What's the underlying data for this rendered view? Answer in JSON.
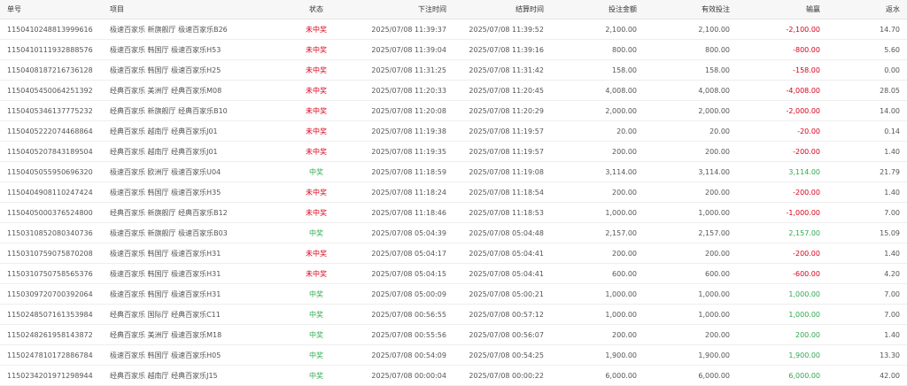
{
  "colors": {
    "lose": "#d9001b",
    "win": "#2fa84f",
    "neutral": "#555555"
  },
  "table": {
    "headers": [
      "单号",
      "项目",
      "状态",
      "下注时间",
      "结算时间",
      "投注金额",
      "有效投注",
      "输赢",
      "返水"
    ],
    "rows": [
      [
        "1150410248813999616",
        "极速百家乐 新旗舰厅 极速百家乐B26",
        "未中奖",
        "2025/07/08 11:39:37",
        "2025/07/08 11:39:52",
        "2,100.00",
        "2,100.00",
        "-2,100.00",
        "14.70"
      ],
      [
        "1150410111932888576",
        "极速百家乐 韩国厅 极速百家乐H53",
        "未中奖",
        "2025/07/08 11:39:04",
        "2025/07/08 11:39:16",
        "800.00",
        "800.00",
        "-800.00",
        "5.60"
      ],
      [
        "1150408187216736128",
        "极速百家乐 韩国厅 极速百家乐H25",
        "未中奖",
        "2025/07/08 11:31:25",
        "2025/07/08 11:31:42",
        "158.00",
        "158.00",
        "-158.00",
        "0.00"
      ],
      [
        "1150405450064251392",
        "经典百家乐 美洲厅 经典百家乐M08",
        "未中奖",
        "2025/07/08 11:20:33",
        "2025/07/08 11:20:45",
        "4,008.00",
        "4,008.00",
        "-4,008.00",
        "28.05"
      ],
      [
        "1150405346137775232",
        "经典百家乐 新旗舰厅 经典百家乐B10",
        "未中奖",
        "2025/07/08 11:20:08",
        "2025/07/08 11:20:29",
        "2,000.00",
        "2,000.00",
        "-2,000.00",
        "14.00"
      ],
      [
        "1150405222074468864",
        "经典百家乐 越南厅 经典百家乐J01",
        "未中奖",
        "2025/07/08 11:19:38",
        "2025/07/08 11:19:57",
        "20.00",
        "20.00",
        "-20.00",
        "0.14"
      ],
      [
        "1150405207843189504",
        "经典百家乐 越南厅 经典百家乐J01",
        "未中奖",
        "2025/07/08 11:19:35",
        "2025/07/08 11:19:57",
        "200.00",
        "200.00",
        "-200.00",
        "1.40"
      ],
      [
        "1150405055950696320",
        "极速百家乐 欧洲厅 极速百家乐U04",
        "中奖",
        "2025/07/08 11:18:59",
        "2025/07/08 11:19:08",
        "3,114.00",
        "3,114.00",
        "3,114.00",
        "21.79"
      ],
      [
        "1150404908110247424",
        "极速百家乐 韩国厅 极速百家乐H35",
        "未中奖",
        "2025/07/08 11:18:24",
        "2025/07/08 11:18:54",
        "200.00",
        "200.00",
        "-200.00",
        "1.40"
      ],
      [
        "1150405000376524800",
        "经典百家乐 新旗舰厅 经典百家乐B12",
        "未中奖",
        "2025/07/08 11:18:46",
        "2025/07/08 11:18:53",
        "1,000.00",
        "1,000.00",
        "-1,000.00",
        "7.00"
      ],
      [
        "1150310852080340736",
        "极速百家乐 新旗舰厅 极速百家乐B03",
        "中奖",
        "2025/07/08 05:04:39",
        "2025/07/08 05:04:48",
        "2,157.00",
        "2,157.00",
        "2,157.00",
        "15.09"
      ],
      [
        "1150310759075870208",
        "极速百家乐 韩国厅 极速百家乐H31",
        "未中奖",
        "2025/07/08 05:04:17",
        "2025/07/08 05:04:41",
        "200.00",
        "200.00",
        "-200.00",
        "1.40"
      ],
      [
        "1150310750758565376",
        "极速百家乐 韩国厅 极速百家乐H31",
        "未中奖",
        "2025/07/08 05:04:15",
        "2025/07/08 05:04:41",
        "600.00",
        "600.00",
        "-600.00",
        "4.20"
      ],
      [
        "1150309720700392064",
        "极速百家乐 韩国厅 极速百家乐H31",
        "中奖",
        "2025/07/08 05:00:09",
        "2025/07/08 05:00:21",
        "1,000.00",
        "1,000.00",
        "1,000.00",
        "7.00"
      ],
      [
        "1150248507161353984",
        "经典百家乐 国际厅 经典百家乐C11",
        "中奖",
        "2025/07/08 00:56:55",
        "2025/07/08 00:57:12",
        "1,000.00",
        "1,000.00",
        "1,000.00",
        "7.00"
      ],
      [
        "1150248261958143872",
        "经典百家乐 美洲厅 极速百家乐M18",
        "中奖",
        "2025/07/08 00:55:56",
        "2025/07/08 00:56:07",
        "200.00",
        "200.00",
        "200.00",
        "1.40"
      ],
      [
        "1150247810172886784",
        "极速百家乐 韩国厅 极速百家乐H05",
        "中奖",
        "2025/07/08 00:54:09",
        "2025/07/08 00:54:25",
        "1,900.00",
        "1,900.00",
        "1,900.00",
        "13.30"
      ],
      [
        "1150234201971298944",
        "经典百家乐 越南厅 经典百家乐J15",
        "中奖",
        "2025/07/08 00:00:04",
        "2025/07/08 00:00:22",
        "6,000.00",
        "6,000.00",
        "6,000.00",
        "42.00"
      ]
    ]
  }
}
